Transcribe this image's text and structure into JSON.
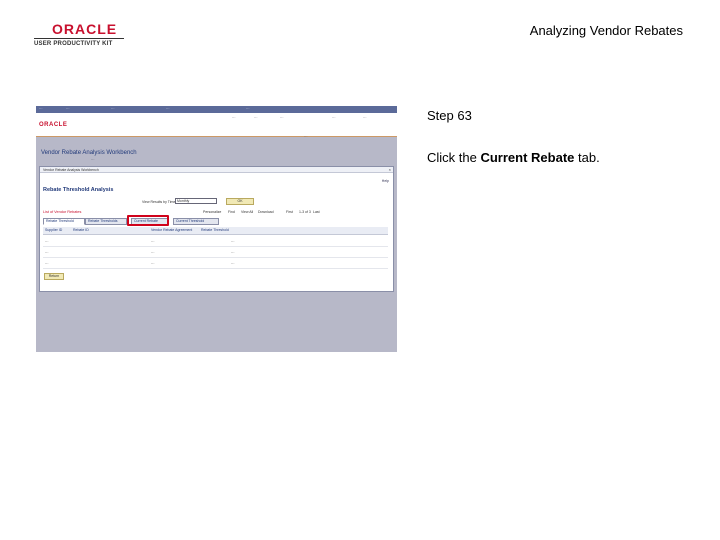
{
  "header": {
    "logo_oracle": "ORACLE",
    "logo_upk": "USER PRODUCTIVITY KIT",
    "slide_title": "Analyzing Vendor Rebates"
  },
  "step": {
    "number": "Step 63",
    "instruction_prefix": "Click the ",
    "instruction_target": "Current Rebate",
    "instruction_suffix": " tab."
  },
  "screenshot": {
    "oracle_logo": "ORACLE",
    "workbench_title": "Vendor Rebate Analysis Workbench",
    "window_title": "Vendor Rebate Analysis Workbench",
    "help_link": "Help",
    "page_heading": "Rebate Threshold Analysis",
    "view_label": "View Results by Time Period",
    "view_value": "Monthly",
    "ok_button": "OK",
    "grid_title": "List of Vendor Rebates",
    "grid_nav": [
      "Personalize",
      "Find",
      "View All",
      "Download",
      "First",
      "1-3 of 3",
      "Last"
    ],
    "tabs": [
      "Rebate Threshold",
      "Rebate Thresholds",
      "Current Rebate",
      "Current Threshold"
    ],
    "columns": [
      "Supplier ID",
      "Rebate ID",
      "Vendor Rebate Agreement",
      "Rebate Threshold"
    ],
    "return_button": "Return"
  },
  "colors": {
    "oracle_red": "#c8102e",
    "highlight_red": "#d0021b",
    "panel_bg": "#b7b8c8"
  }
}
